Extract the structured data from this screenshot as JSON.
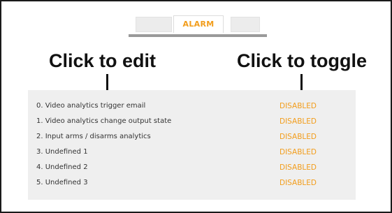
{
  "tabs": {
    "active_label": "ALARM"
  },
  "annotations": {
    "edit_label": "Click to edit",
    "toggle_label": "Click to toggle"
  },
  "alarms": [
    {
      "name": "0. Video analytics trigger email",
      "state": "DISABLED"
    },
    {
      "name": "1. Video analytics change output state",
      "state": "DISABLED"
    },
    {
      "name": "2. Input arms / disarms analytics",
      "state": "DISABLED"
    },
    {
      "name": "3. Undefined 1",
      "state": "DISABLED"
    },
    {
      "name": "4. Undefined 2",
      "state": "DISABLED"
    },
    {
      "name": "5. Undefined 3",
      "state": "DISABLED"
    }
  ],
  "colors": {
    "accent": "#f29d1b",
    "panel_bg": "#efefef",
    "tab_underline": "#9a9a9a"
  }
}
